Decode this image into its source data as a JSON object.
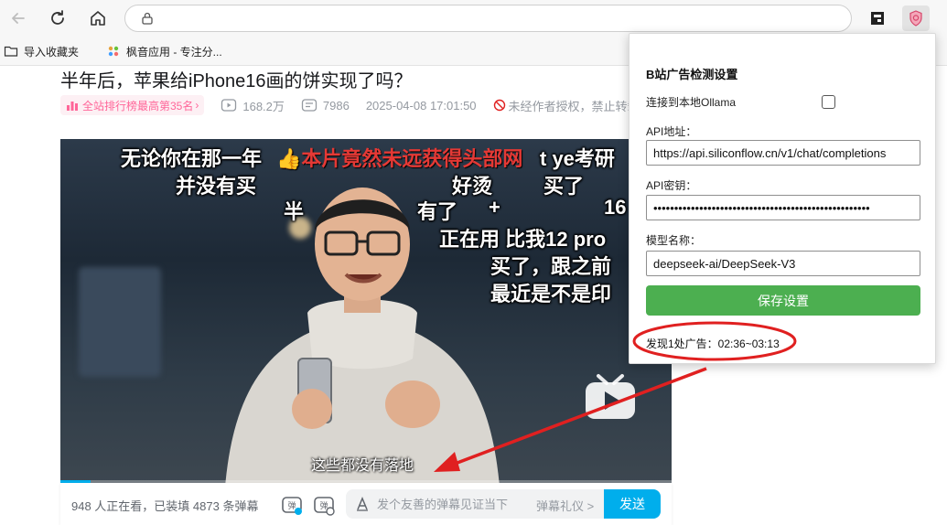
{
  "browser": {
    "url": "",
    "bookmarks": [
      {
        "label": "导入收藏夹",
        "icon": "folder-import-icon"
      },
      {
        "label": "枫音应用 - 专注分...",
        "icon": "app-icon"
      }
    ]
  },
  "video": {
    "title": "半年后，苹果给iPhone16画的饼实现了吗？",
    "rank_badge": "全站排行榜最高第35名",
    "views": "168.2万",
    "danmaku_count": "7986",
    "publish_time": "2025-04-08 17:01:50",
    "warning": "未经作者授权，禁止转载",
    "subtitle": "这些都没有落地",
    "progress_fraction": 0.05,
    "danmaku": [
      {
        "text": "无论你在那一年"
      },
      {
        "text": "👍本片竟然未远获得头部网"
      },
      {
        "text": "t ye考研"
      },
      {
        "text": "并没有买"
      },
      {
        "text": "好烫"
      },
      {
        "text": "买了"
      },
      {
        "text": "半"
      },
      {
        "text": "有了"
      },
      {
        "text": "+"
      },
      {
        "text": "16"
      },
      {
        "text": "正在用 比我12 pro"
      },
      {
        "text": "买了，跟之前"
      },
      {
        "text": "最近是不是印"
      }
    ]
  },
  "danmaku_bar": {
    "watching_text": "948 人正在看，已装填 4873 条弹幕",
    "placeholder": "发个友善的弹幕见证当下",
    "etiquette": "弹幕礼仪 >",
    "send_label": "发送"
  },
  "popup": {
    "title": "B站广告检测设置",
    "ollama_label": "连接到本地Ollama",
    "ollama_checked": false,
    "api_url_label": "API地址：",
    "api_url_value": "https://api.siliconflow.cn/v1/chat/completions",
    "api_key_label": "API密钥：",
    "api_key_value": "••••••••••••••••••••••••••••••••••••••••••••••••••••",
    "model_label": "模型名称：",
    "model_value": "deepseek-ai/DeepSeek-V3",
    "save_label": "保存设置",
    "result_text": "发现1处广告：02:36~03:13"
  },
  "colors": {
    "bili_blue": "#00aeec",
    "bili_pink": "#ff6699",
    "save_green": "#4caf50",
    "annotation_red": "#e02020"
  }
}
